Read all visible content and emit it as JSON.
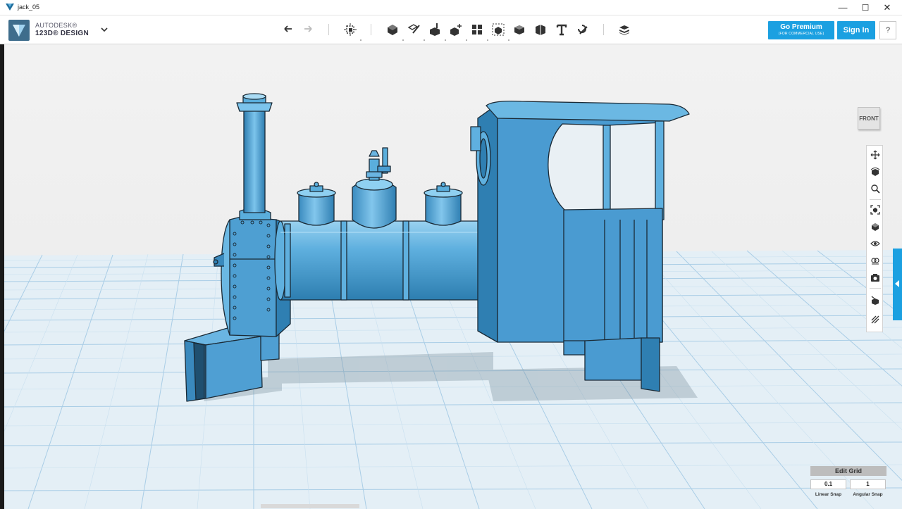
{
  "window": {
    "title": "jack_05",
    "min_glyph": "—",
    "max_glyph": "☐",
    "close_glyph": "✕"
  },
  "app": {
    "brand_line1": "AUTODESK®",
    "brand_line2": "123D® DESIGN"
  },
  "toolbar": {
    "icons": [
      "undo-icon",
      "redo-icon",
      "transform-icon",
      "primitives-icon",
      "sketch-icon",
      "construct-icon",
      "modify-icon",
      "pattern-icon",
      "grouping-icon",
      "combine-icon",
      "measure-icon",
      "text-icon",
      "snap-icon",
      "material-icon"
    ],
    "premium_label": "Go Premium",
    "premium_sub": "(FOR COMMERCIAL USE)",
    "signin_label": "Sign In",
    "help_label": "?"
  },
  "viewcube": {
    "face_label": "FRONT"
  },
  "navbar": {
    "icons": [
      "pan-icon",
      "orbit-icon",
      "zoom-icon",
      "fit-icon",
      "view-icon",
      "visibility-icon",
      "materials-icon",
      "snapshot-icon",
      "snap-left-icon",
      "snap-right-icon"
    ]
  },
  "grid_panel": {
    "title": "Edit Grid",
    "linear_value": "0.1",
    "angular_value": "1",
    "linear_label": "Linear Snap",
    "angular_label": "Angular Snap"
  },
  "colors": {
    "accent": "#1ba0e1",
    "model_blue": "#4a9fd3",
    "grid_line": "#9cc7e3",
    "grid_floor": "#e3eef5",
    "sky": "#f0f0f0"
  }
}
